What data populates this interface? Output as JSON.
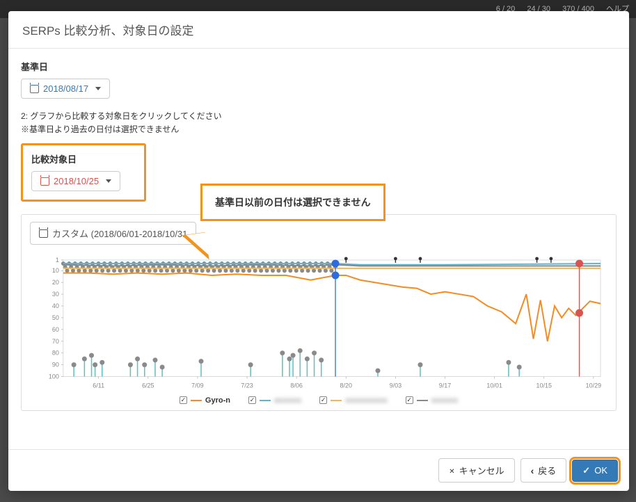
{
  "topbar": {
    "item1": "6 / 20",
    "item2": "24 / 30",
    "item3": "370 / 400",
    "help": "ヘルプ"
  },
  "modal": {
    "title": "SERPs 比較分析、対象日の設定",
    "baseline_label": "基準日",
    "baseline_date": "2018/08/17",
    "help_line1": "2: グラフから比較する対象日をクリックしてください",
    "help_line2": "※基準日より過去の日付は選択できません",
    "compare_label": "比較対象日",
    "compare_date": "2018/10/25",
    "range_label": "カスタム (2018/06/01-2018/10/31",
    "callout": "基準日以前の日付は選択できません"
  },
  "footer": {
    "cancel": "キャンセル",
    "back": "戻る",
    "ok": "OK"
  },
  "chart_data": {
    "type": "line",
    "ylabel": "",
    "xlabel": "",
    "ylim": [
      1,
      100
    ],
    "yticks": [
      1,
      10,
      20,
      30,
      40,
      50,
      60,
      70,
      80,
      90,
      100
    ],
    "xticks": [
      "6/11",
      "6/25",
      "7/09",
      "7/23",
      "8/06",
      "8/20",
      "9/03",
      "9/17",
      "10/01",
      "10/15",
      "10/29"
    ],
    "x_range": [
      "2018/06/01",
      "2018/10/31"
    ],
    "pin_x": [
      "8/20",
      "9/03",
      "9/10",
      "10/13",
      "10/17"
    ],
    "baseline_marker_x": "8/17",
    "compare_marker_x": "10/25",
    "baseline_marker_points": [
      4,
      14
    ],
    "compare_marker_points": [
      4,
      46
    ],
    "series": [
      {
        "name": "Gyro-n",
        "color": "#f68b1f",
        "x": [
          "6/01",
          "6/08",
          "6/15",
          "6/22",
          "6/29",
          "7/06",
          "7/13",
          "7/20",
          "7/27",
          "8/03",
          "8/10",
          "8/17",
          "8/20",
          "8/24",
          "8/28",
          "9/01",
          "9/05",
          "9/09",
          "9/13",
          "9/17",
          "9/21",
          "9/25",
          "9/29",
          "10/03",
          "10/07",
          "10/10",
          "10/12",
          "10/14",
          "10/16",
          "10/18",
          "10/20",
          "10/22",
          "10/24",
          "10/26",
          "10/28",
          "10/31"
        ],
        "values": [
          12,
          12,
          13,
          12,
          13,
          12,
          14,
          13,
          14,
          14,
          18,
          14,
          14,
          18,
          20,
          22,
          24,
          25,
          30,
          28,
          30,
          32,
          40,
          45,
          55,
          30,
          68,
          35,
          70,
          40,
          50,
          42,
          48,
          42,
          36,
          38
        ]
      },
      {
        "name": "series-b",
        "color": "#5bb6d0",
        "x": [
          "6/01",
          "8/17",
          "8/24",
          "9/17",
          "10/31"
        ],
        "values": [
          4,
          4,
          5,
          5,
          4
        ]
      },
      {
        "name": "series-c",
        "color": "#f5b84a",
        "x": [
          "6/01",
          "8/17",
          "10/31"
        ],
        "values": [
          8,
          8,
          8
        ]
      },
      {
        "name": "series-d",
        "color": "#888888",
        "x": [
          "6/01",
          "6/15",
          "6/29",
          "7/13",
          "7/27",
          "8/10",
          "8/17",
          "8/24",
          "10/31"
        ],
        "values": [
          5,
          6,
          5,
          6,
          5,
          6,
          5,
          6,
          6
        ]
      }
    ],
    "dense_gray_dots": {
      "x_range": [
        "6/01",
        "8/17"
      ],
      "y_band": [
        4,
        10
      ],
      "count": 140
    },
    "lollipops": [
      {
        "x": "6/04",
        "y": 90
      },
      {
        "x": "6/07",
        "y": 85
      },
      {
        "x": "6/09",
        "y": 82
      },
      {
        "x": "6/10",
        "y": 90
      },
      {
        "x": "6/12",
        "y": 88
      },
      {
        "x": "6/20",
        "y": 90
      },
      {
        "x": "6/22",
        "y": 85
      },
      {
        "x": "6/24",
        "y": 90
      },
      {
        "x": "6/27",
        "y": 86
      },
      {
        "x": "6/29",
        "y": 92
      },
      {
        "x": "7/10",
        "y": 87
      },
      {
        "x": "7/24",
        "y": 90
      },
      {
        "x": "8/02",
        "y": 80
      },
      {
        "x": "8/04",
        "y": 85
      },
      {
        "x": "8/05",
        "y": 82
      },
      {
        "x": "8/07",
        "y": 78
      },
      {
        "x": "8/09",
        "y": 85
      },
      {
        "x": "8/11",
        "y": 80
      },
      {
        "x": "8/13",
        "y": 86
      },
      {
        "x": "8/29",
        "y": 95
      },
      {
        "x": "9/10",
        "y": 90
      },
      {
        "x": "10/05",
        "y": 88
      },
      {
        "x": "10/08",
        "y": 92
      }
    ],
    "legend": [
      "Gyro-n",
      "assssss",
      "sssssssssss",
      "sssssss"
    ]
  }
}
